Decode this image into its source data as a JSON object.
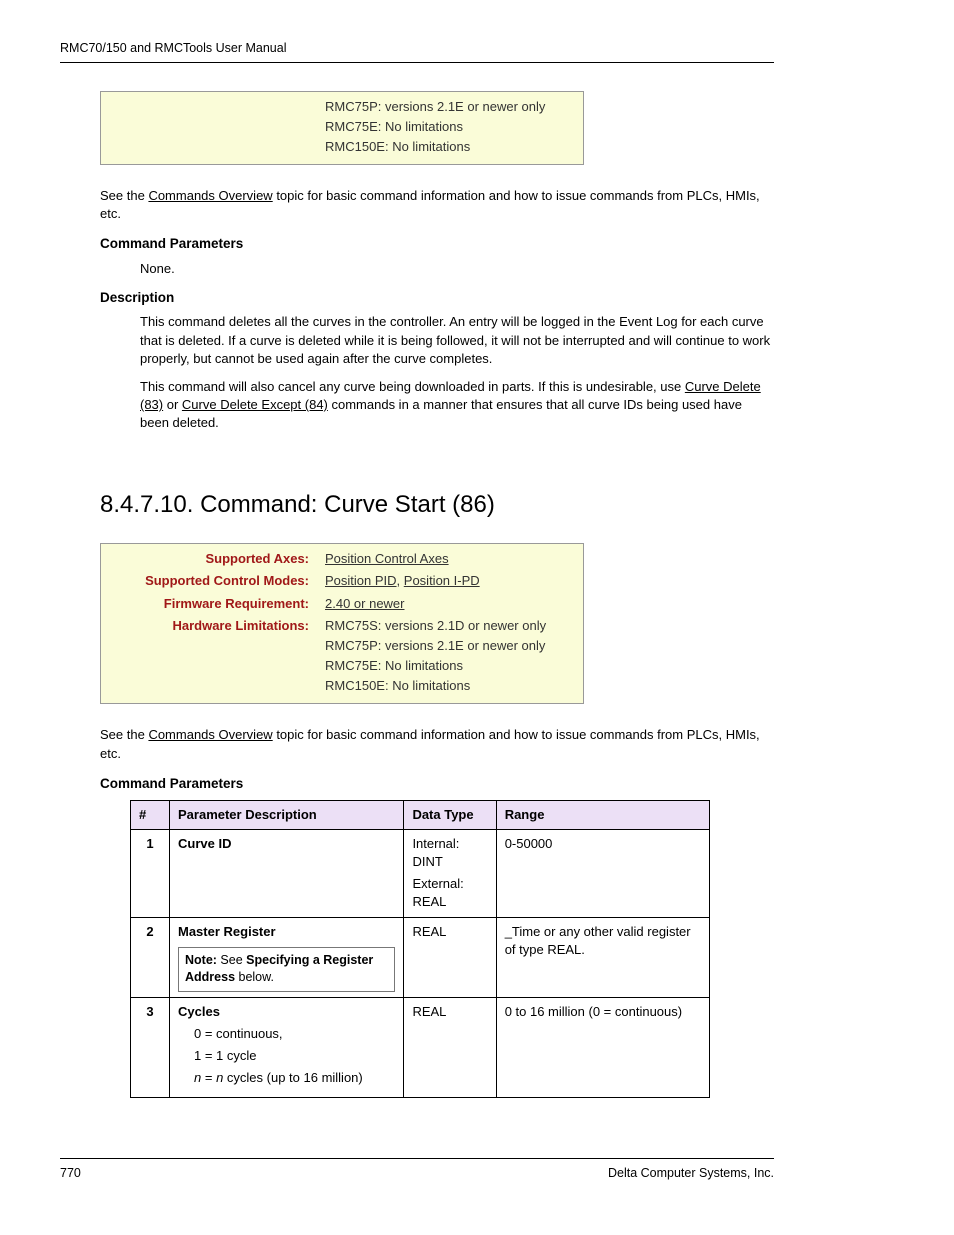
{
  "header": {
    "title": "RMC70/150 and RMCTools User Manual"
  },
  "footer": {
    "page": "770",
    "company": "Delta Computer Systems, Inc."
  },
  "box1": {
    "lines": {
      "l1": "RMC75P: versions 2.1E or newer only",
      "l2": "RMC75E: No limitations",
      "l3": "RMC150E: No limitations"
    }
  },
  "intro1": {
    "prefix": "See the ",
    "link": "Commands Overview",
    "suffix": " topic for basic command information and how to issue commands from PLCs, HMIs, etc."
  },
  "sec1": {
    "title": "Command Parameters",
    "body": "None."
  },
  "sec2": {
    "title": "Description",
    "p1": "This command deletes all the curves in the controller. An entry will be logged in the Event Log for each curve that is deleted.  If a curve is deleted while it is being followed, it will not be interrupted and will continue to work properly, but cannot be used again after the curve completes.",
    "p2_prefix": "This command will also cancel any curve being downloaded in parts. If this is undesirable, use ",
    "p2_link1": "Curve Delete (83)",
    "p2_mid": " or ",
    "p2_link2": "Curve Delete Except (84)",
    "p2_suffix": " commands in a manner that ensures that all curve IDs being used have been deleted."
  },
  "h2": "8.4.7.10. Command: Curve Start (86)",
  "box2": {
    "r1": {
      "label": "Supported Axes:",
      "value_link": "Position Control Axes"
    },
    "r2": {
      "label": "Supported Control Modes:",
      "link1": "Position PID",
      "sep": ", ",
      "link2": "Position I-PD"
    },
    "r3": {
      "label": "Firmware Requirement:",
      "value_link": "2.40 or newer"
    },
    "r4": {
      "label": "Hardware Limitations:",
      "l1": "RMC75S: versions 2.1D or newer only",
      "l2": "RMC75P: versions 2.1E or newer only",
      "l3": "RMC75E: No limitations",
      "l4": "RMC150E: No limitations"
    }
  },
  "intro2": {
    "prefix": "See the ",
    "link": "Commands Overview",
    "suffix": " topic for basic command information and how to issue commands from PLCs, HMIs, etc."
  },
  "sec3": {
    "title": "Command Parameters"
  },
  "table": {
    "headers": {
      "c1": "#",
      "c2": "Parameter Description",
      "c3": "Data Type",
      "c4": "Range"
    },
    "r1": {
      "num": "1",
      "desc": "Curve ID",
      "dt1": "Internal: DINT",
      "dt2": "External: REAL",
      "range": "0-50000"
    },
    "r2": {
      "num": "2",
      "desc": "Master Register",
      "note_prefix": "Note:",
      "note_mid": " See ",
      "note_bold": "Specifying a Register Address",
      "note_suffix": " below.",
      "dt": "REAL",
      "range": "_Time or any other valid register of type REAL."
    },
    "r3": {
      "num": "3",
      "desc": "Cycles",
      "opt1_a": "0 = continuous,",
      "opt2_a": "1 = 1 cycle",
      "opt3_i1": "n",
      "opt3_m": " = ",
      "opt3_i2": "n",
      "opt3_s": " cycles (up to 16 million)",
      "dt": "REAL",
      "range": "0 to 16 million (0 = continuous)"
    }
  }
}
